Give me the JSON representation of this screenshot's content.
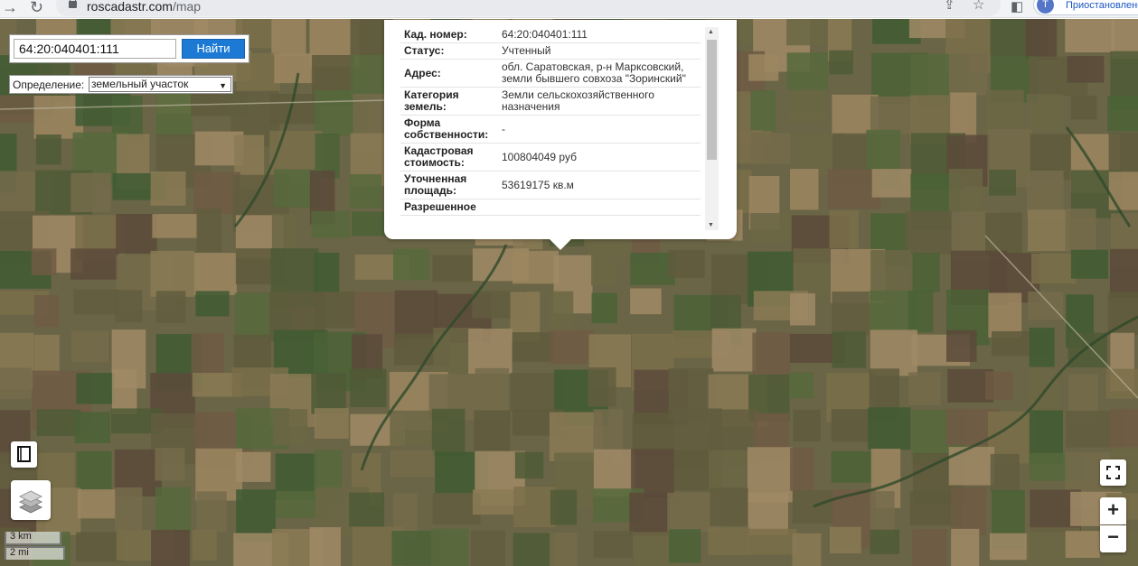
{
  "browser": {
    "url_domain": "roscadastr.com",
    "url_path": "/map",
    "profile_initial": "Т",
    "profile_label": "Приостановлено"
  },
  "search": {
    "value": "64:20:040401:111",
    "button": "Найти"
  },
  "definition": {
    "label": "Определение:",
    "selected": "земельный участок"
  },
  "popup": {
    "rows": [
      {
        "key": "Кад. номер:",
        "value": "64:20:040401:111"
      },
      {
        "key": "Статус:",
        "value": "Учтенный"
      },
      {
        "key": "Адрес:",
        "value": "обл. Саратовская, р-н Марксовский, земли бывшего совхоза \"Зоринский\""
      },
      {
        "key": "Категория земель:",
        "value": "Земли сельскохозяйственного назначения"
      },
      {
        "key": "Форма собственности:",
        "value": "-"
      },
      {
        "key": "Кадастровая стоимость:",
        "value": "100804049 руб"
      },
      {
        "key": "Уточненная площадь:",
        "value": "53619175 кв.м"
      },
      {
        "key": "Разрешенное",
        "value": ""
      }
    ]
  },
  "controls": {
    "zoom_in": "+",
    "zoom_out": "−"
  },
  "scale": {
    "km": "3 km",
    "mi": "2 mi"
  }
}
